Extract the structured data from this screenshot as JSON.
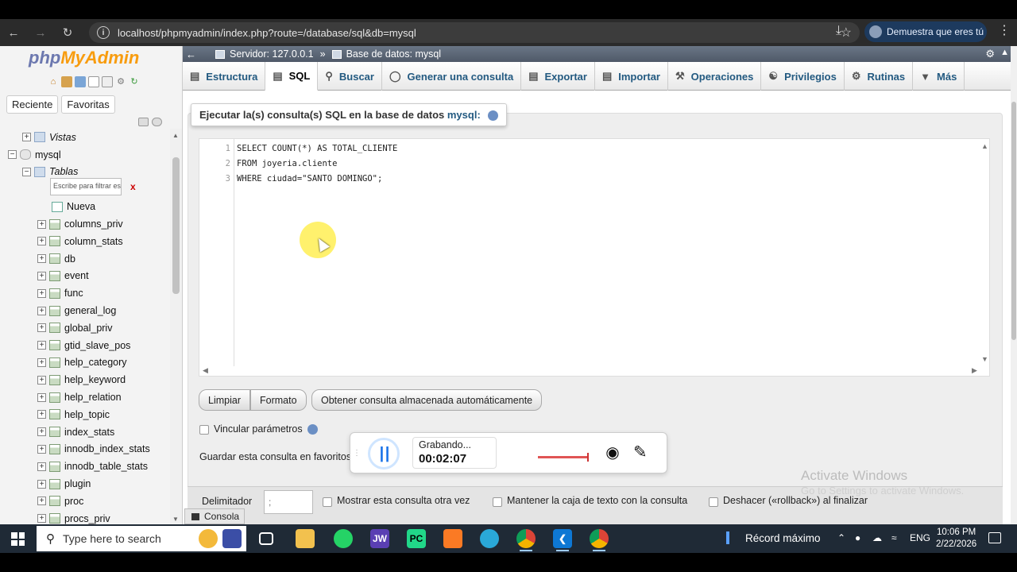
{
  "browser": {
    "url": "localhost/phpmyadmin/index.php?route=/database/sql&db=mysql",
    "profile_label": "Demuestra que eres tú"
  },
  "nav": {
    "logo_php": "php",
    "logo_myadmin": "MyAdmin",
    "tab_recent": "Reciente",
    "tab_favorites": "Favoritas",
    "views_label": "Vistas",
    "db_name": "mysql",
    "tables_label": "Tablas",
    "filter_placeholder": "Escribe para filtrar es",
    "filter_clear": "x",
    "new_label": "Nueva",
    "tables": [
      "columns_priv",
      "column_stats",
      "db",
      "event",
      "func",
      "general_log",
      "global_priv",
      "gtid_slave_pos",
      "help_category",
      "help_keyword",
      "help_relation",
      "help_topic",
      "index_stats",
      "innodb_index_stats",
      "innodb_table_stats",
      "plugin",
      "proc",
      "procs_priv"
    ]
  },
  "breadcrumb": {
    "server": "Servidor: 127.0.0.1",
    "separator": "»",
    "database": "Base de datos: mysql"
  },
  "tabs": [
    "Estructura",
    "SQL",
    "Buscar",
    "Generar una consulta",
    "Exportar",
    "Importar",
    "Operaciones",
    "Privilegios",
    "Rutinas",
    "Más"
  ],
  "sql_panel": {
    "legend_prefix": "Ejecutar la(s) consulta(s) SQL en la base de datos",
    "legend_db": "mysql:",
    "lines": [
      {
        "num": "1",
        "text": "SELECT COUNT(*) AS TOTAL_CLIENTE"
      },
      {
        "num": "2",
        "text": "FROM joyeria.cliente"
      },
      {
        "num": "3",
        "text": "WHERE ciudad=\"SANTO DOMINGO\";"
      }
    ],
    "btn_clear": "Limpiar",
    "btn_format": "Formato",
    "btn_stored": "Obtener consulta almacenada automáticamente",
    "bind_params": "Vincular parámetros",
    "save_fav": "Guardar esta consulta en favoritos",
    "delimiter_label": "Delimitador",
    "delimiter_value": ";",
    "show_again": "Mostrar esta consulta otra vez",
    "keep_box": "Mantener la caja de texto con la consulta",
    "rollback": "Deshacer («rollback») al finalizar",
    "console": "Consola"
  },
  "recorder": {
    "status": "Grabando...",
    "time": "00:02:07"
  },
  "watermark": {
    "line1": "Activate Windows",
    "line2": "Go to Settings to activate Windows."
  },
  "taskbar": {
    "search_placeholder": "Type here to search",
    "record_app": "Récord máximo",
    "lang": "ENG",
    "time": "10:06 PM",
    "date": "2/22/2026"
  },
  "colors": {
    "link": "#235a81",
    "logo_php": "#6c78af",
    "logo_myadmin": "#f89c0e",
    "taskbar": "#1f2a36"
  }
}
